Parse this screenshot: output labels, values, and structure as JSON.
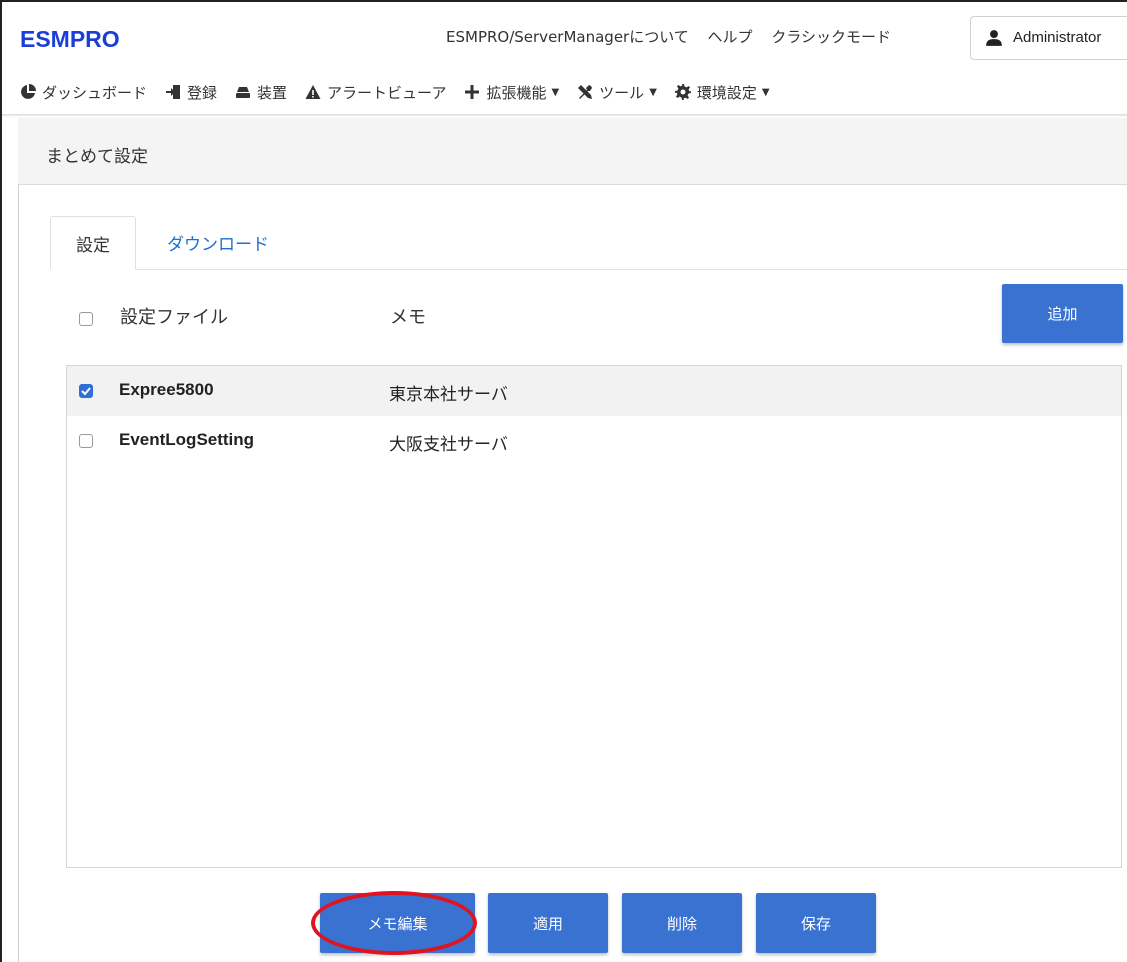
{
  "app": {
    "brand": "ESMPRO"
  },
  "header": {
    "links": [
      "ESMPRO/ServerManagerについて",
      "ヘルプ",
      "クラシックモード"
    ],
    "user": "Administrator"
  },
  "nav": {
    "items": [
      {
        "label": "ダッシュボード",
        "icon": "dashboard-icon",
        "dropdown": false
      },
      {
        "label": "登録",
        "icon": "register-icon",
        "dropdown": false
      },
      {
        "label": "装置",
        "icon": "device-icon",
        "dropdown": false
      },
      {
        "label": "アラートビューア",
        "icon": "alert-icon",
        "dropdown": false
      },
      {
        "label": "拡張機能",
        "icon": "plus-icon",
        "dropdown": true
      },
      {
        "label": "ツール",
        "icon": "tools-icon",
        "dropdown": true
      },
      {
        "label": "環境設定",
        "icon": "gear-icon",
        "dropdown": true
      }
    ]
  },
  "page": {
    "title": "まとめて設定"
  },
  "tabs": [
    {
      "label": "設定",
      "active": true
    },
    {
      "label": "ダウンロード",
      "active": false
    }
  ],
  "list": {
    "headers": {
      "file": "設定ファイル",
      "memo": "メモ"
    },
    "add_label": "追加",
    "rows": [
      {
        "name": "Expree5800",
        "memo": "東京本社サーバ",
        "checked": true
      },
      {
        "name": "EventLogSetting",
        "memo": "大阪支社サーバ",
        "checked": false
      }
    ]
  },
  "actions": {
    "memo_edit": "メモ編集",
    "apply": "適用",
    "delete": "削除",
    "save": "保存"
  },
  "colors": {
    "brand": "#1a3fd6",
    "primary_button": "#3a72d2",
    "tab_link": "#1e6fd0",
    "highlight_ellipse": "#e0141e"
  }
}
